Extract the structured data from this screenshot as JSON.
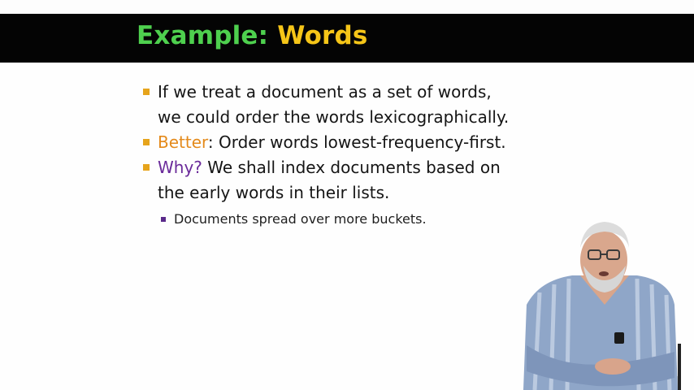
{
  "slide": {
    "title_part1": "Example:",
    "title_part2": "Words",
    "bullets": [
      {
        "line1": "If we treat a document as a set of words,",
        "line2": "we could order the words lexicographically."
      },
      {
        "keyword": "Better",
        "rest": ": Order words lowest-frequency-first."
      },
      {
        "keyword": "Why?",
        "rest_line1": " We shall index documents based on",
        "rest_line2": "the early words in their lists."
      }
    ],
    "sub_bullet": "Documents spread over more buckets."
  },
  "colors": {
    "title_green": "#4ed04e",
    "title_yellow": "#f5c518",
    "bullet_square": "#e6a41c",
    "keyword_orange": "#e48a1b",
    "keyword_purple": "#6a2a9a",
    "title_bar": "#040404"
  }
}
